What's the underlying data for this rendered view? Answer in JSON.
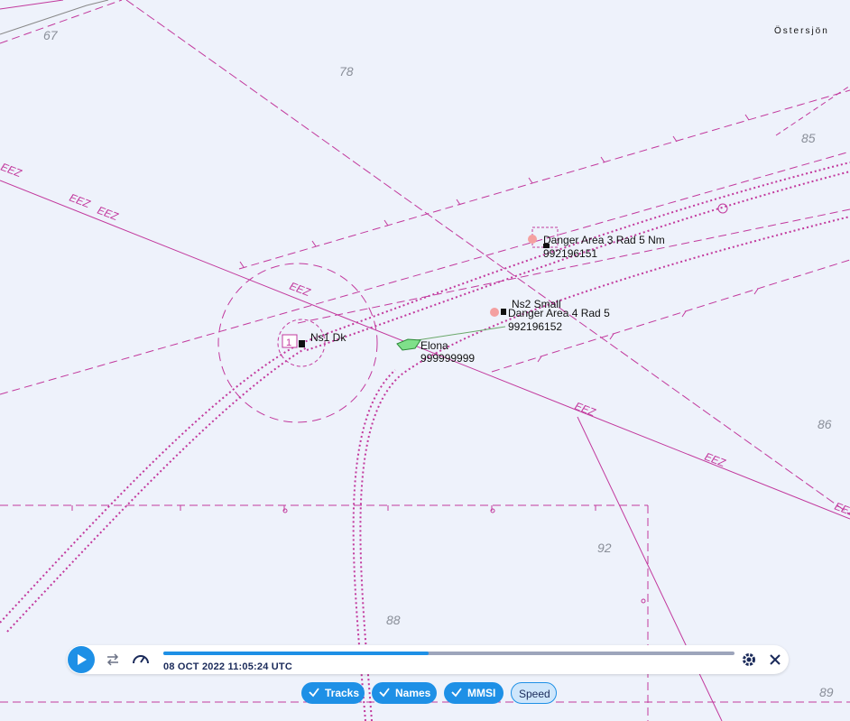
{
  "map": {
    "region_label": "Östersjön",
    "depth_labels": [
      "67",
      "78",
      "85",
      "86",
      "92",
      "88",
      "89"
    ],
    "eez_label": "EEZ",
    "vessels": [
      {
        "name": "Ns1 Dk",
        "mmsi": ""
      },
      {
        "name": "Ns2 Small",
        "mmsi": ""
      },
      {
        "name": "Danger Area 3 Rad 5 Nm",
        "mmsi": "992196151"
      },
      {
        "name": "Danger Area 4 Rad 5",
        "mmsi": "992196152"
      },
      {
        "name": "Elona",
        "mmsi": "999999999"
      }
    ],
    "buoy_label": "1"
  },
  "playback": {
    "timestamp": "08 OCT 2022 11:05:24 UTC",
    "progress": 0.465
  },
  "toggles": [
    {
      "label": "Tracks",
      "checked": true
    },
    {
      "label": "Names",
      "checked": true
    },
    {
      "label": "MMSI",
      "checked": true
    },
    {
      "label": "Speed",
      "checked": false
    }
  ],
  "colors": {
    "route": "#c2399d",
    "accent": "#1e90e6",
    "vessel": "#7fe08a",
    "target": "#f4a0a0"
  }
}
